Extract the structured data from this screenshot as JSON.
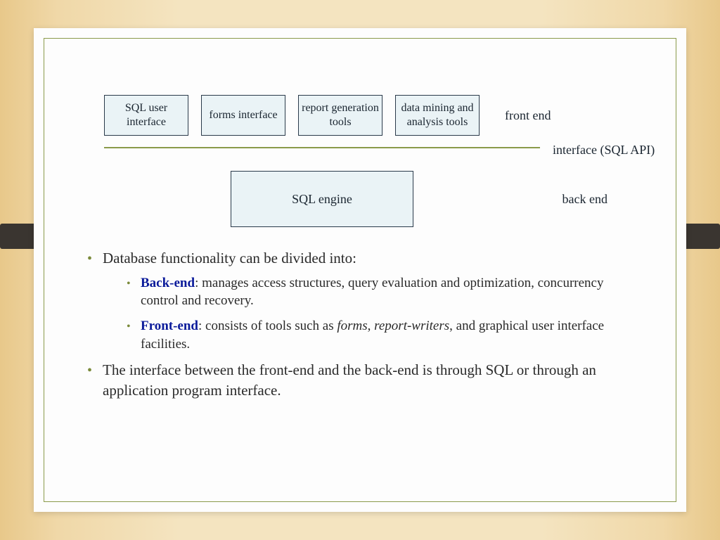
{
  "diagram": {
    "front_boxes": [
      "SQL user interface",
      "forms interface",
      "report generation tools",
      "data mining and analysis tools"
    ],
    "front_label": "front end",
    "interface_label": "interface (SQL  API)",
    "engine_box": "SQL engine",
    "back_label": "back end"
  },
  "bullets": {
    "b1": "Database functionality can be divided into:",
    "b1a_label": "Back-end",
    "b1a_text": ": manages access structures, query evaluation and optimization, concurrency control and recovery.",
    "b1b_label": "Front-end",
    "b1b_pre": ": consists of tools such as ",
    "b1b_i1": "forms",
    "b1b_mid1": ", ",
    "b1b_i2": "report-writers",
    "b1b_post": ", and graphical user interface facilities.",
    "b2": "The interface between the front-end and the back-end is through SQL or through an application program interface."
  }
}
